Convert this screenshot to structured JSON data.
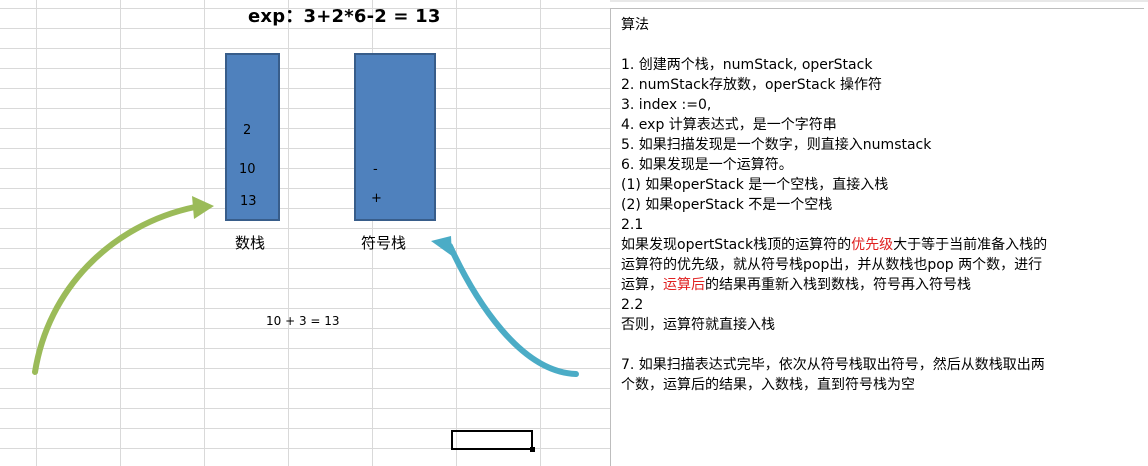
{
  "sheet": {
    "expression": "exp：3+2*6-2  = 13",
    "num_stack_label": "数栈",
    "oper_stack_label": "符号栈",
    "num_stack_values": [
      "2",
      "10",
      "13"
    ],
    "oper_stack_values": [
      "-",
      "+"
    ],
    "calc_note": "10 + 3 = 13"
  },
  "panel": {
    "title": "算法",
    "l1": "1. 创建两个栈，numStack, operStack",
    "l2": "2. numStack存放数，operStack 操作符",
    "l3": "3. index :=0,",
    "l4": "4. exp 计算表达式，是一个字符串",
    "l5": "5. 如果扫描发现是一个数字，则直接入numstack",
    "l6": "6. 如果发现是一个运算符。",
    "l7": "(1) 如果operStack 是一个空栈，直接入栈",
    "l8": "(2) 如果operStack 不是一个空栈",
    "l9": "2.1",
    "l10a": "如果发现opertStack栈顶的运算符的",
    "l10b": "优先级",
    "l10c": "大于等于当前准备入栈的",
    "l11": "运算符的优先级，就从符号栈pop出，并从数栈也pop 两个数，进行",
    "l12a": "运算，",
    "l12b": "运算后",
    "l12c": "的结果再重新入栈到数栈，符号再入符号栈",
    "l13": "2.2",
    "l14": "否则，运算符就直接入栈",
    "l15": "7. 如果扫描表达式完毕，依次从符号栈取出符号，然后从数栈取出两",
    "l16": "个数，运算后的结果，入数栈，直到符号栈为空"
  },
  "colors": {
    "stack_fill": "#4f81bd",
    "stack_border": "#385d8a",
    "green_arrow": "#9bbb59",
    "blue_arrow": "#4bacc6",
    "highlight": "#e02020"
  }
}
